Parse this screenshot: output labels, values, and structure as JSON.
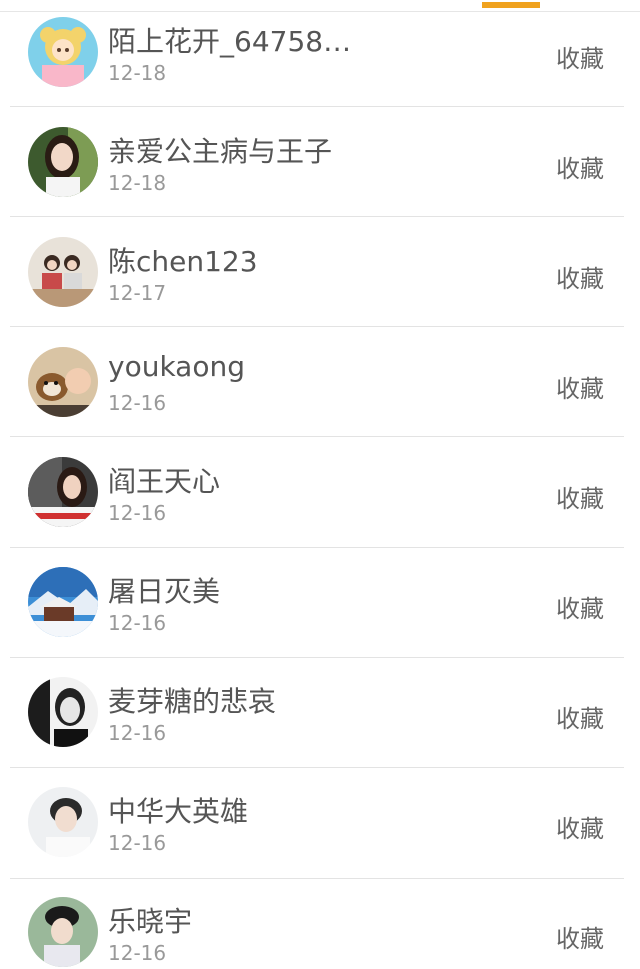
{
  "tab_indicator_color": "#f0a21e",
  "items": [
    {
      "name": "陌上花开_64758…",
      "date": "12-18",
      "action": "收藏",
      "avatar": "cartoon-girl-avatar"
    },
    {
      "name": "亲爱公主病与王子",
      "date": "12-18",
      "action": "收藏",
      "avatar": "girl-portrait-avatar"
    },
    {
      "name": "陈chen123",
      "date": "12-17",
      "action": "收藏",
      "avatar": "couple-photo-avatar"
    },
    {
      "name": "youkaong",
      "date": "12-16",
      "action": "收藏",
      "avatar": "dog-and-baby-avatar"
    },
    {
      "name": "阎王天心",
      "date": "12-16",
      "action": "收藏",
      "avatar": "girl-with-caption-avatar"
    },
    {
      "name": "屠日灭美",
      "date": "12-16",
      "action": "收藏",
      "avatar": "snowy-house-avatar"
    },
    {
      "name": "麦芽糖的悲哀",
      "date": "12-16",
      "action": "收藏",
      "avatar": "bw-portrait-avatar"
    },
    {
      "name": "中华大英雄",
      "date": "12-16",
      "action": "收藏",
      "avatar": "boy-portrait-avatar"
    },
    {
      "name": "乐晓宇",
      "date": "12-16",
      "action": "收藏",
      "avatar": "costume-portrait-avatar"
    }
  ]
}
